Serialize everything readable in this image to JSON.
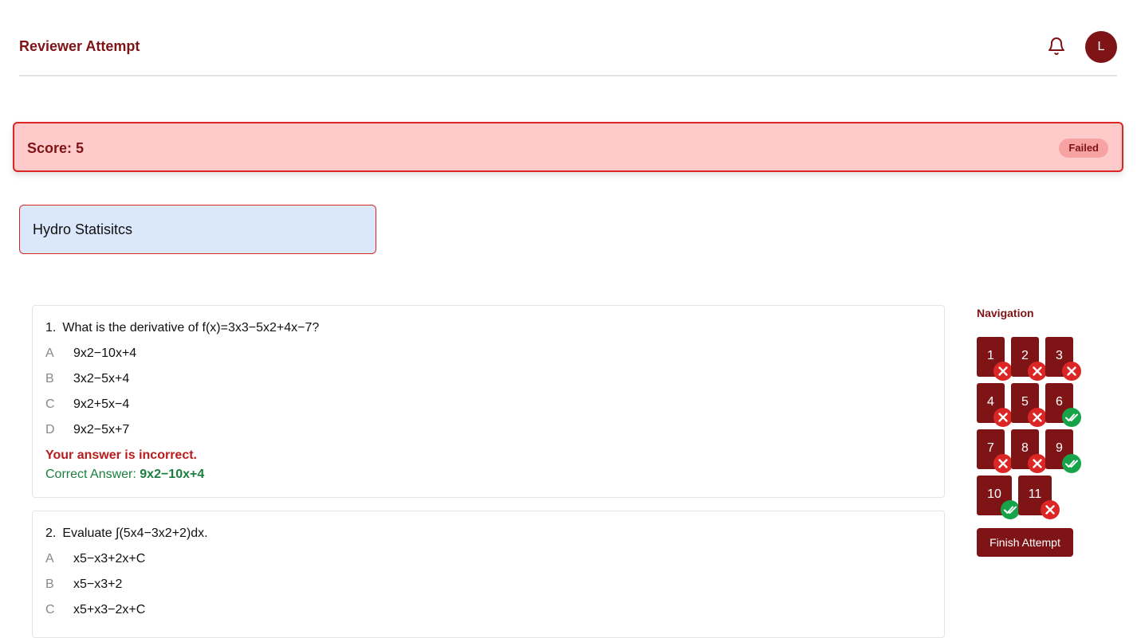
{
  "header": {
    "title": "Reviewer Attempt",
    "avatar_initial": "L",
    "bell_icon": "bell-icon"
  },
  "score": {
    "label": "Score: 5",
    "status": "Failed"
  },
  "subject": {
    "name": "Hydro Statisitcs"
  },
  "questions": [
    {
      "number": "1.",
      "text": "What is the derivative of f(x)=3x3−5x2+4x−7?",
      "options": [
        {
          "letter": "A",
          "text": "9x2−10x+4"
        },
        {
          "letter": "B",
          "text": "3x2−5x+4"
        },
        {
          "letter": "C",
          "text": "9x2+5x−4"
        },
        {
          "letter": "D",
          "text": "9x2−5x+7"
        }
      ],
      "feedback": "Your answer is incorrect.",
      "correct_label": "Correct Answer:",
      "correct_value": "9x2−10x+4"
    },
    {
      "number": "2.",
      "text": "Evaluate ∫(5x4−3x2+2)dx.",
      "options": [
        {
          "letter": "A",
          "text": "x5−x3+2x+C"
        },
        {
          "letter": "B",
          "text": "x5−x3+2"
        },
        {
          "letter": "C",
          "text": "x5+x3−2x+C"
        }
      ]
    }
  ],
  "navigation": {
    "title": "Navigation",
    "items": [
      {
        "label": "1",
        "result": "wrong"
      },
      {
        "label": "2",
        "result": "wrong"
      },
      {
        "label": "3",
        "result": "wrong"
      },
      {
        "label": "4",
        "result": "wrong"
      },
      {
        "label": "5",
        "result": "wrong"
      },
      {
        "label": "6",
        "result": "correct"
      },
      {
        "label": "7",
        "result": "wrong"
      },
      {
        "label": "8",
        "result": "wrong"
      },
      {
        "label": "9",
        "result": "correct"
      },
      {
        "label": "10",
        "result": "correct"
      },
      {
        "label": "11",
        "result": "wrong"
      }
    ],
    "finish_label": "Finish Attempt"
  },
  "colors": {
    "brand": "#7f1416",
    "wrong": "#dc2626",
    "correct": "#16a34a"
  }
}
